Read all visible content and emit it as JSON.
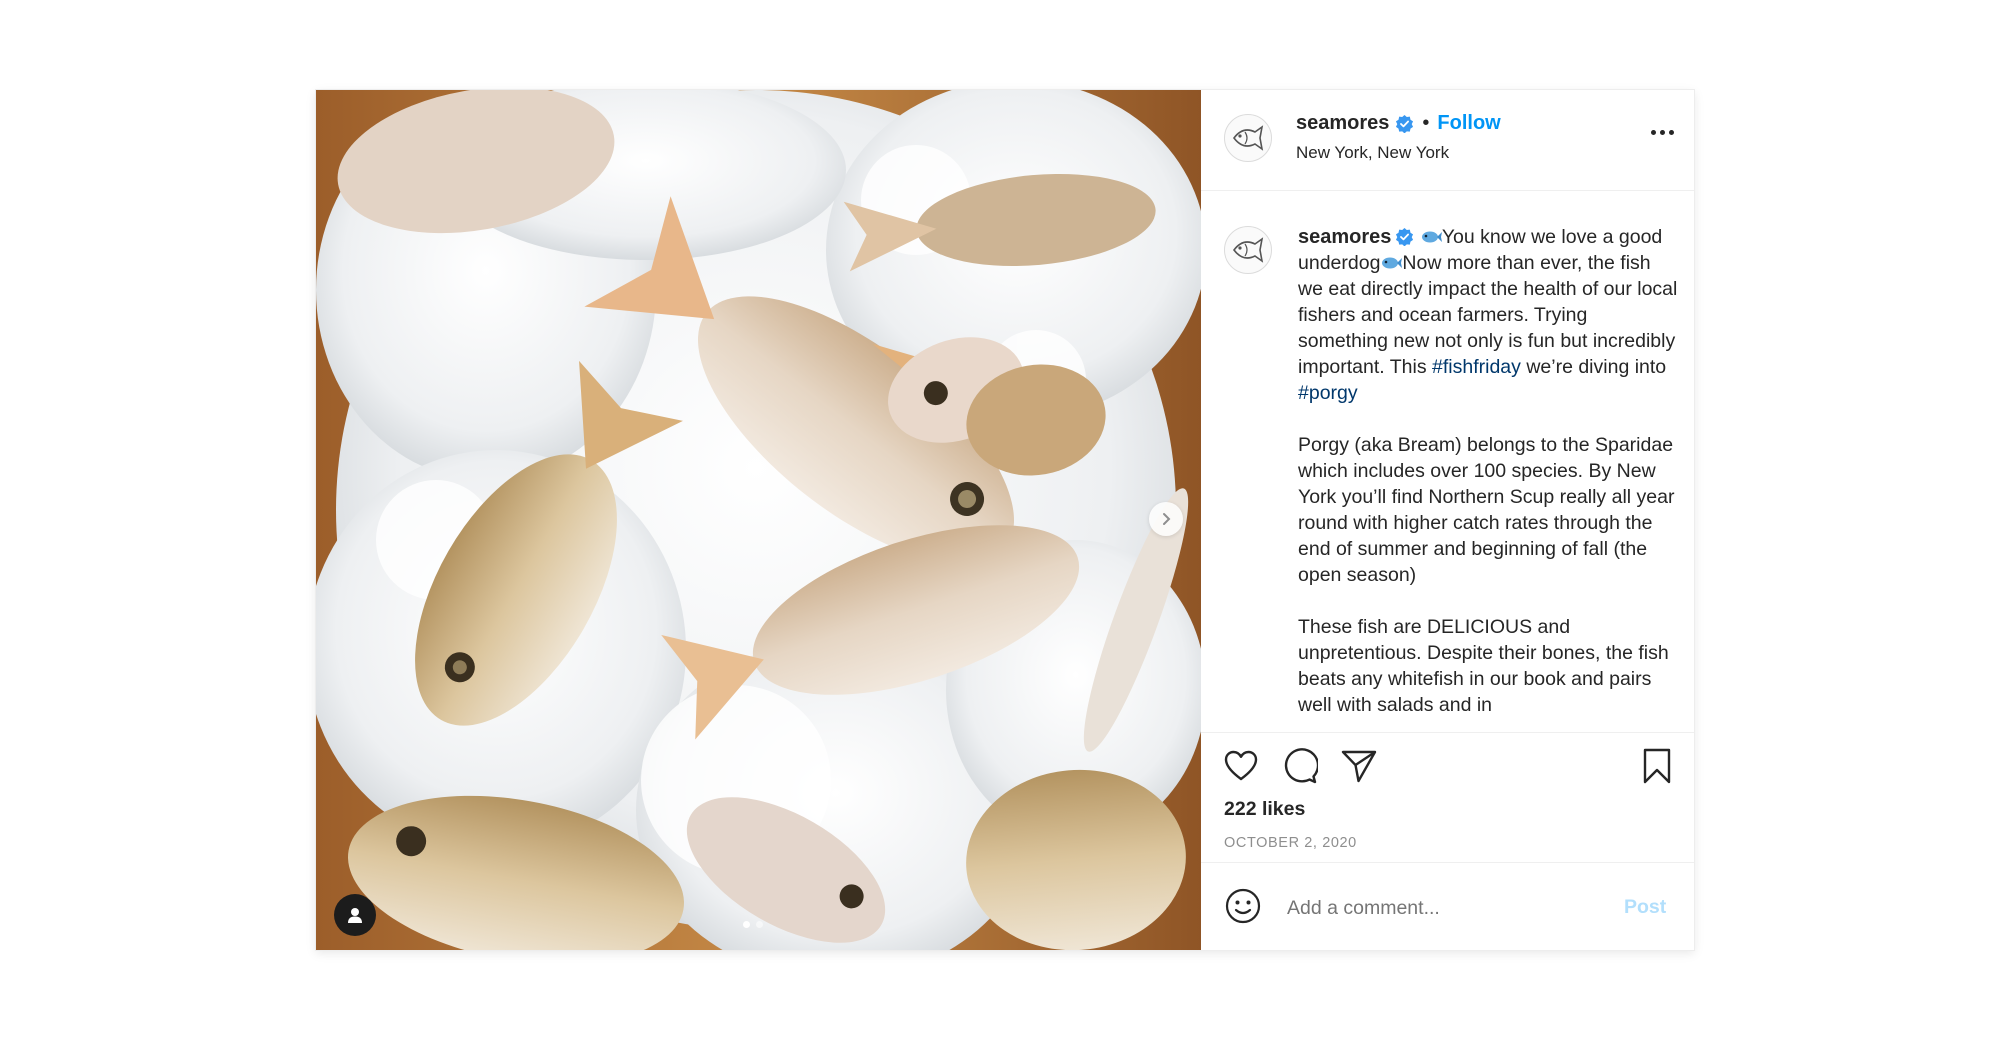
{
  "post": {
    "username": "seamores",
    "follow_label": "Follow",
    "separator": "•",
    "location": "New York, New York",
    "caption": {
      "username": "seamores",
      "p1_a": "You know we love a good underdog",
      "p1_b": "Now more than ever, the fish we eat directly impact the health of our local fishers and ocean farmers. Trying something new not only is fun but incredibly important. This ",
      "hashtag1": "#fishfriday",
      "p1_c": " we’re diving into ",
      "hashtag2": "#porgy",
      "p2": "Porgy (aka Bream) belongs to the Sparidae which includes over 100 species. By New York you’ll find Northern Scup really all year round with higher catch rates through the end of summer and beginning of fall (the open season)",
      "p3": "These fish are DELICIOUS and unpretentious. Despite their bones, the fish beats any whitefish in our book and pairs well with salads and in"
    },
    "likes": "222 likes",
    "date": "OCTOBER 2, 2020",
    "comment_placeholder": "Add a comment...",
    "post_label": "Post"
  },
  "carousel": {
    "current": 1,
    "total": 2
  },
  "icons": {
    "avatar": "fish-logo-icon",
    "verified": "verified-badge-icon",
    "more": "more-options-icon",
    "like": "heart-icon",
    "comment": "comment-icon",
    "share": "share-icon",
    "save": "bookmark-icon",
    "emoji": "emoji-icon",
    "next": "chevron-right-icon",
    "tagged": "user-tag-icon",
    "caption_emoji": "fish-emoji-icon"
  },
  "colors": {
    "link": "#0095f6",
    "hashtag": "#00376b",
    "muted": "#8e8e8e",
    "post_disabled": "#b2dffc"
  }
}
